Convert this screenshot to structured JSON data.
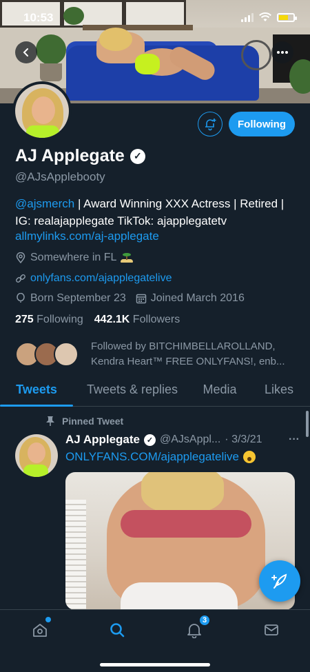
{
  "status_bar": {
    "time": "10:53"
  },
  "profile": {
    "name": "AJ Applegate",
    "handle": "@AJsApplebooty",
    "follow_button": "Following",
    "bio_mention": "@ajsmerch",
    "bio_text": " | Award Winning XXX Actress | Retired | IG: realajapplegate TikTok: ajapplegatetv",
    "bio_link": "allmylinks.com/aj-applegate",
    "location": "Somewhere in FL",
    "website": "onlyfans.com/ajapplegatelive",
    "born": "Born September 23",
    "joined": "Joined March 2016",
    "following_count": "275",
    "following_label": "Following",
    "followers_count": "442.1K",
    "followers_label": "Followers",
    "followed_by_line1": "Followed by BITCHIMBELLAROLLAND,",
    "followed_by_line2": "Kendra Heart™ FREE ONLYFANS!, enb..."
  },
  "tabs": [
    {
      "label": "Tweets",
      "active": true
    },
    {
      "label": "Tweets & replies",
      "active": false
    },
    {
      "label": "Media",
      "active": false
    },
    {
      "label": "Likes",
      "active": false
    }
  ],
  "tweet": {
    "pinned_label": "Pinned Tweet",
    "author_name": "AJ Applegate",
    "author_handle": "@AJsAppl...",
    "date": "· 3/3/21",
    "more": "···",
    "text": "ONLYFANS.COM/ajapplegatelive"
  },
  "bottom_nav": {
    "notifications_badge": "3"
  },
  "colors": {
    "background": "#15202b",
    "accent": "#1d9bf0",
    "secondary_text": "#8b98a5",
    "divider": "#38444d"
  },
  "icons": {
    "back": "chevron-left-icon",
    "more": "more-horizontal-icon",
    "bell": "bell-plus-icon",
    "verified": "verified-badge-icon",
    "location": "map-pin-icon",
    "link": "link-icon",
    "birthday": "balloon-icon",
    "calendar": "calendar-icon",
    "pin": "pin-icon",
    "compose": "compose-feather-icon",
    "home": "home-icon",
    "search": "search-icon",
    "notifications": "bell-icon",
    "messages": "mail-icon"
  }
}
